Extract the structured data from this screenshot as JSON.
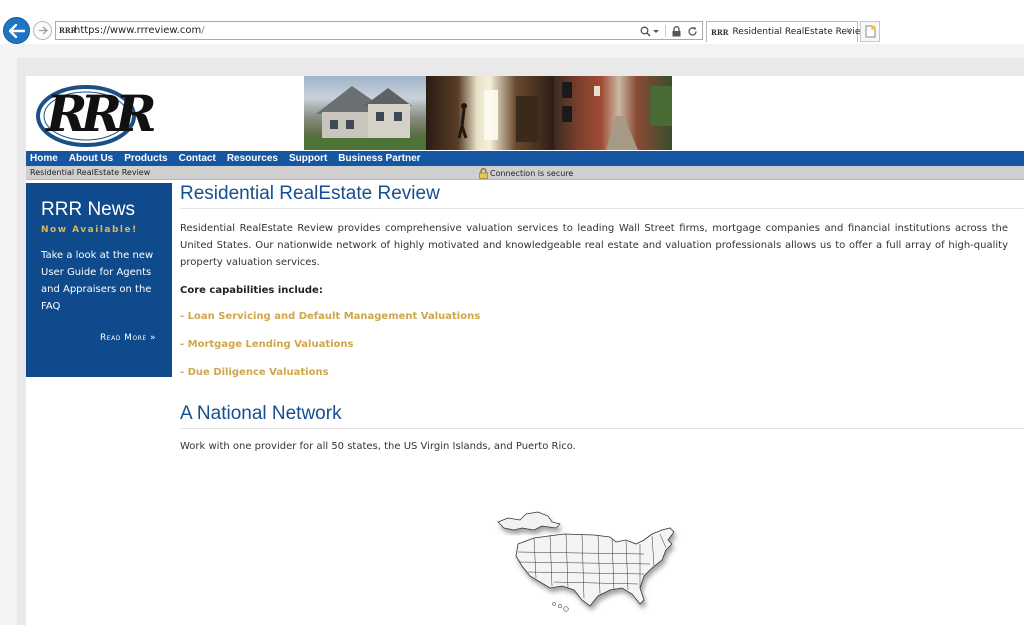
{
  "browser": {
    "url_host": "https://www.rrreview.com",
    "url_path": "/",
    "favicon_text": "RRR",
    "tab_title": "Residential RealEstate Review",
    "tab_close": "×"
  },
  "site": {
    "logo_text": "RRR",
    "nav": [
      "Home",
      "About Us",
      "Products",
      "Contact",
      "Resources",
      "Support",
      "Business Partner"
    ],
    "breadcrumb": "Residential RealEstate Review",
    "secure_text": "Connection is secure"
  },
  "news": {
    "title": "RRR News",
    "badge": "Now Available!",
    "blurb": "Take a look at the new User Guide for Agents and Appraisers on the FAQ",
    "read_more": "Read More »"
  },
  "main": {
    "title": "Residential RealEstate Review",
    "intro": "Residential RealEstate Review provides comprehensive valuation services to leading Wall Street firms, mortgage companies and financial institutions across the United States. Our nationwide network of highly motivated and knowledgeable real estate and valuation professionals allows us to offer a full array of high-quality property valuation services.",
    "core_heading": "Core capabilities include:",
    "capabilities": [
      "- Loan Servicing and Default Management Valuations",
      "- Mortgage Lending Valuations",
      "- Due Diligence Valuations"
    ],
    "network_title": "A National Network",
    "network_text": "Work with one provider for all 50 states, the US Virgin Islands, and Puerto Rico."
  },
  "colors": {
    "nav_blue": "#1657a3",
    "news_blue": "#0e4a8c",
    "heading_blue": "#164f8f",
    "gold": "#cfa64a"
  },
  "icons": [
    "back-arrow-icon",
    "forward-arrow-icon",
    "search-icon",
    "lock-icon",
    "refresh-icon",
    "new-tab-icon",
    "close-icon"
  ]
}
